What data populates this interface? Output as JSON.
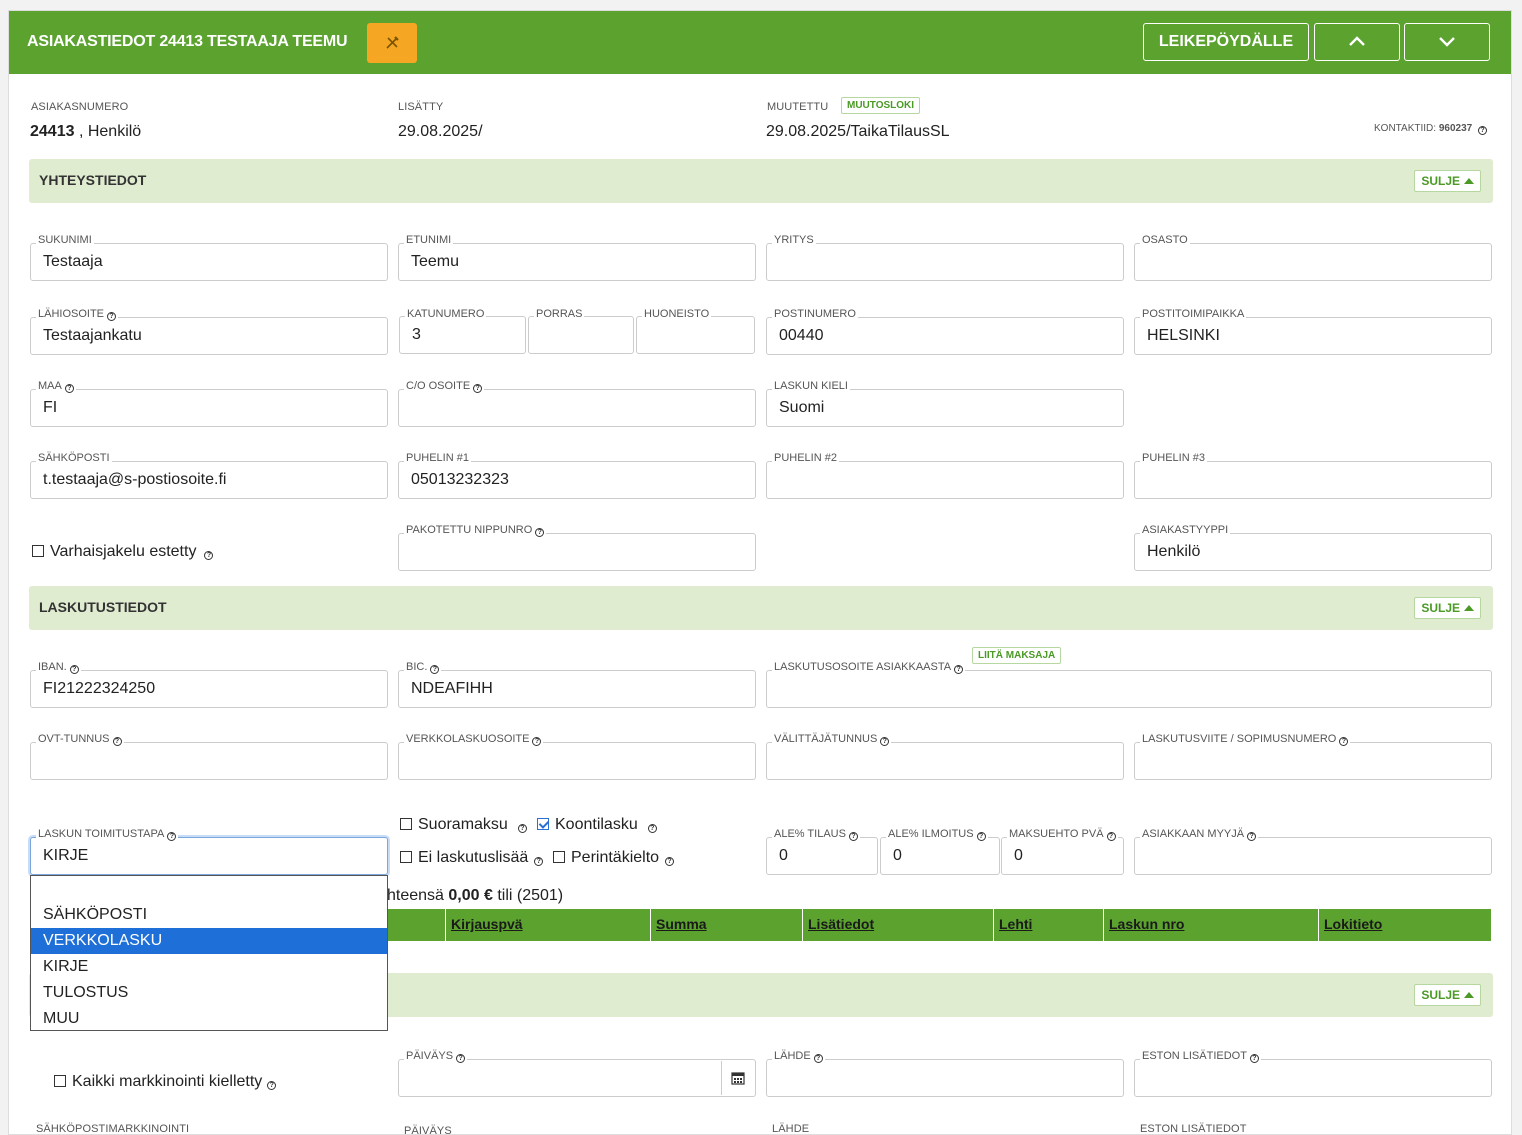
{
  "header": {
    "title": "ASIAKASTIEDOT 24413 TESTAAJA TEEMU",
    "clipboard_label": "LEIKEPÖYDÄLLE"
  },
  "meta": {
    "asiakasnumero_label": "ASIAKASNUMERO",
    "asiakasnumero_value": "24413",
    "asiakasnumero_type": " , Henkilö",
    "lisatty_label": "LISÄTTY",
    "lisatty_value": "29.08.2025/",
    "muutettu_label": "MUUTETTU",
    "muutosloki_label": "MUUTOSLOKI",
    "muutettu_value": "29.08.2025/TaikaTilausSL",
    "kontaktiid_label": "KONTAKTIID:",
    "kontaktiid_value": "960237"
  },
  "sections": {
    "yhteystiedot": "YHTEYSTIEDOT",
    "laskutustiedot": "LASKUTUSTIEDOT",
    "sulje": "SULJE"
  },
  "contact": {
    "sukunimi": {
      "label": "SUKUNIMI",
      "value": "Testaaja"
    },
    "etunimi": {
      "label": "ETUNIMI",
      "value": "Teemu"
    },
    "yritys": {
      "label": "YRITYS",
      "value": ""
    },
    "osasto": {
      "label": "OSASTO",
      "value": ""
    },
    "lahiosoite": {
      "label": "LÄHIOSOITE",
      "value": "Testaajankatu"
    },
    "katunumero": {
      "label": "KATUNUMERO",
      "value": "3"
    },
    "porras": {
      "label": "PORRAS",
      "value": ""
    },
    "huoneisto": {
      "label": "HUONEISTO",
      "value": ""
    },
    "postinumero": {
      "label": "POSTINUMERO",
      "value": "00440"
    },
    "postitoimipaikka": {
      "label": "POSTITOIMIPAIKKA",
      "value": "HELSINKI"
    },
    "maa": {
      "label": "MAA",
      "value": "FI"
    },
    "co_osoite": {
      "label": "C/O OSOITE",
      "value": ""
    },
    "laskun_kieli": {
      "label": "LASKUN KIELI",
      "value": "Suomi"
    },
    "sahkoposti": {
      "label": "SÄHKÖPOSTI",
      "value": "t.testaaja@s-postiosoite.fi"
    },
    "puhelin1": {
      "label": "PUHELIN #1",
      "value": "05013232323"
    },
    "puhelin2": {
      "label": "PUHELIN #2",
      "value": ""
    },
    "puhelin3": {
      "label": "PUHELIN #3",
      "value": ""
    },
    "varhaisjakelu": "Varhaisjakelu estetty",
    "pakotettu": {
      "label": "PAKOTETTU NIPPUNRO",
      "value": ""
    },
    "asiakastyyppi": {
      "label": "ASIAKASTYYPPI",
      "value": "Henkilö"
    }
  },
  "billing": {
    "iban": {
      "label": "IBAN.",
      "value": "FI21222324250"
    },
    "bic": {
      "label": "BIC.",
      "value": "NDEAFIHH"
    },
    "laskutusosoite": {
      "label": "LASKUTUSOSOITE ASIAKKAASTA",
      "value": ""
    },
    "liita_maksaja": "LIITÄ MAKSAJA",
    "ovt": {
      "label": "OVT-TUNNUS",
      "value": ""
    },
    "verkkolaskuosoite": {
      "label": "VERKKOLASKUOSOITE",
      "value": ""
    },
    "valittajatunnus": {
      "label": "VÄLITTÄJÄTUNNUS",
      "value": ""
    },
    "laskutusviite": {
      "label": "LASKUTUSVIITE / SOPIMUSNUMERO",
      "value": ""
    },
    "toimitustapa": {
      "label": "LASKUN TOIMITUSTAPA",
      "value": "KIRJE"
    },
    "suoramaksu": "Suoramaksu",
    "koontilasku": "Koontilasku",
    "ei_laskutuslisaa": "Ei laskutuslisää",
    "perintakielto": "Perintäkielto",
    "ale_tilaus": {
      "label": "ALE% TILAUS",
      "value": "0"
    },
    "ale_ilmoitus": {
      "label": "ALE% ILMOITUS",
      "value": "0"
    },
    "maksuehto": {
      "label": "MAKSUEHTO PVÄ",
      "value": "0"
    },
    "myyja": {
      "label": "ASIAKKAAN MYYJÄ",
      "value": ""
    }
  },
  "dropdown_options": [
    "",
    "SÄHKÖPOSTI",
    "VERKKOLASKU",
    "KIRJE",
    "TULOSTUS",
    "MUU"
  ],
  "summary": {
    "prefix": "hteensä ",
    "amount": "0,00 €",
    "suffix": " tili (2501)"
  },
  "table_columns": [
    "Kirjauspvä",
    "Summa",
    "Lisätiedot",
    "Lehti",
    "Laskun nro",
    "Lokitieto"
  ],
  "marketing": {
    "kaikki_kielletty": "Kaikki markkinointi kielletty",
    "paivays": {
      "label": "PÄIVÄYS",
      "value": ""
    },
    "lahde": {
      "label": "LÄHDE",
      "value": ""
    },
    "eston_lisatiedot": {
      "label": "ESTON LISÄTIEDOT",
      "value": ""
    },
    "sahkopostimarkkinointi": "SÄHKÖPOSTIMARKKINOINTI",
    "paivays2": "PÄIVÄYS",
    "lahde2": "LÄHDE",
    "eston_lisatiedot2": "ESTON LISÄTIEDOT"
  }
}
